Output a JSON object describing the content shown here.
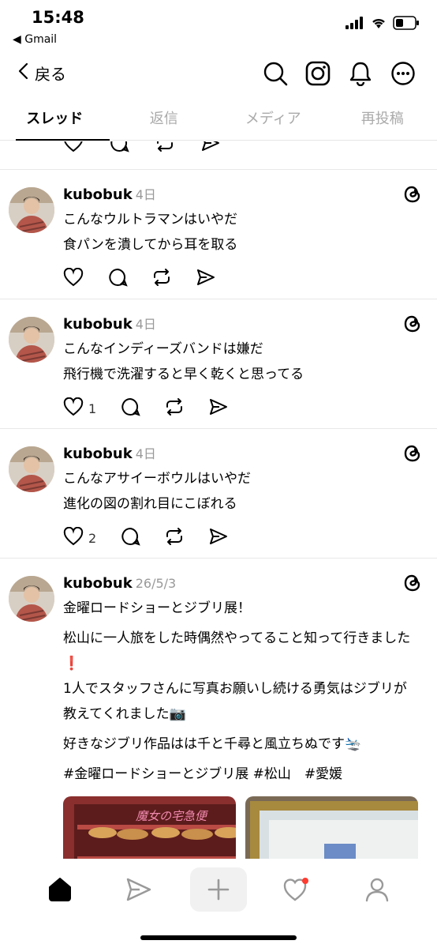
{
  "status": {
    "time": "15:48",
    "back_app": "◀ Gmail",
    "icons": [
      "cellular-icon",
      "wifi-icon",
      "battery-icon"
    ]
  },
  "nav": {
    "back_label": "戻る",
    "icons": [
      "search-icon",
      "instagram-icon",
      "bell-icon",
      "more-icon"
    ]
  },
  "tabs": [
    {
      "label": "スレッド",
      "active": true
    },
    {
      "label": "返信",
      "active": false
    },
    {
      "label": "メディア",
      "active": false
    },
    {
      "label": "再投稿",
      "active": false
    }
  ],
  "posts": [
    {
      "username": "kubobuk",
      "date": "4日",
      "lines": [
        "こんなウルトラマンはいやだ",
        "食パンを潰してから耳を取る"
      ],
      "like_count": ""
    },
    {
      "username": "kubobuk",
      "date": "4日",
      "lines": [
        "こんなインディーズバンドは嫌だ",
        "飛行機で洗濯すると早く乾くと思ってる"
      ],
      "like_count": "1"
    },
    {
      "username": "kubobuk",
      "date": "4日",
      "lines": [
        "こんなアサイーボウルはいやだ",
        "進化の図の割れ目にこぼれる"
      ],
      "like_count": "2"
    },
    {
      "username": "kubobuk",
      "date": "26/5/3",
      "p1": "金曜ロードショーとジブリ展！",
      "p2": "松山に一人旅をした時偶然やってること知って行きました❗️",
      "p3": "1人でスタッフさんに写真お願いし続ける勇気はジブリが教えてくれました📷",
      "p4": "好きなジブリ作品はは千と千尋と風立ちぬです🛬",
      "p5": "#金曜ロードショーとジブリ展 #松山　#愛媛",
      "image1_text": "魔女の宅急便"
    }
  ],
  "bottom_nav": [
    "home-icon",
    "send-icon",
    "plus-icon",
    "heart-icon",
    "profile-icon"
  ],
  "colors": {
    "notification_dot": "#ff3b30",
    "muted": "#999999"
  }
}
